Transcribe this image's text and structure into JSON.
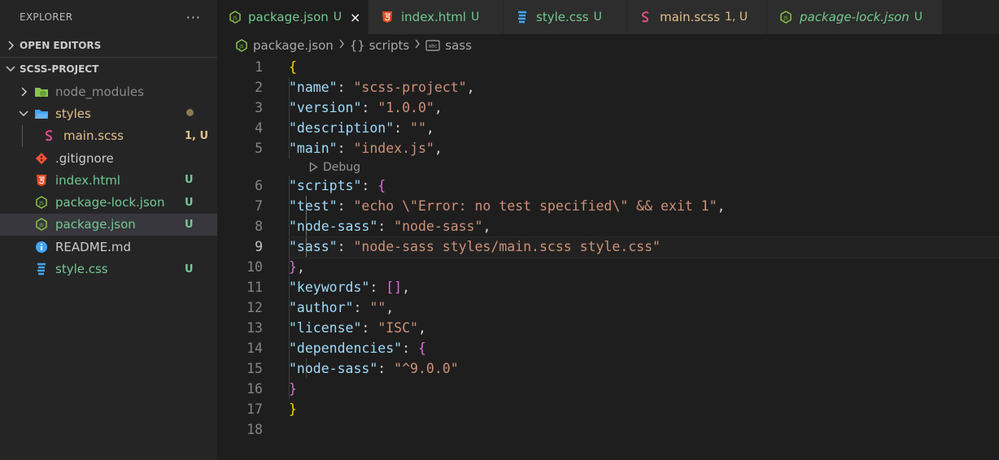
{
  "explorer": {
    "title": "EXPLORER",
    "more": "···",
    "open_editors": "OPEN EDITORS",
    "project": "SCSS-PROJECT",
    "tree": [
      {
        "name": "node_modules",
        "badge": "",
        "type": "folder-node"
      },
      {
        "name": "styles",
        "badge": "",
        "type": "folder-styles"
      },
      {
        "name": "main.scss",
        "badge": "1, U",
        "type": "scss"
      },
      {
        "name": ".gitignore",
        "badge": "",
        "type": "git"
      },
      {
        "name": "index.html",
        "badge": "U",
        "type": "html"
      },
      {
        "name": "package-lock.json",
        "badge": "U",
        "type": "json"
      },
      {
        "name": "package.json",
        "badge": "U",
        "type": "json"
      },
      {
        "name": "README.md",
        "badge": "",
        "type": "info"
      },
      {
        "name": "style.css",
        "badge": "U",
        "type": "css"
      }
    ]
  },
  "tabs": [
    {
      "label": "package.json",
      "badge": "U"
    },
    {
      "label": "index.html",
      "badge": "U"
    },
    {
      "label": "style.css",
      "badge": "U"
    },
    {
      "label": "main.scss",
      "badge": "1, U"
    },
    {
      "label": "package-lock.json",
      "badge": "U"
    }
  ],
  "tab_close": "×",
  "breadcrumb": {
    "file": "package.json",
    "scripts": "{} scripts",
    "sass": "sass"
  },
  "codelens": "Debug",
  "line_numbers": [
    "1",
    "2",
    "3",
    "4",
    "5",
    "6",
    "7",
    "8",
    "9",
    "10",
    "11",
    "12",
    "13",
    "14",
    "15",
    "16",
    "17",
    "18"
  ],
  "colors": {
    "accent_green": "#73c991",
    "accent_yellow": "#e2c08d",
    "json_key": "#9cdcfe",
    "json_string": "#ce9178"
  }
}
